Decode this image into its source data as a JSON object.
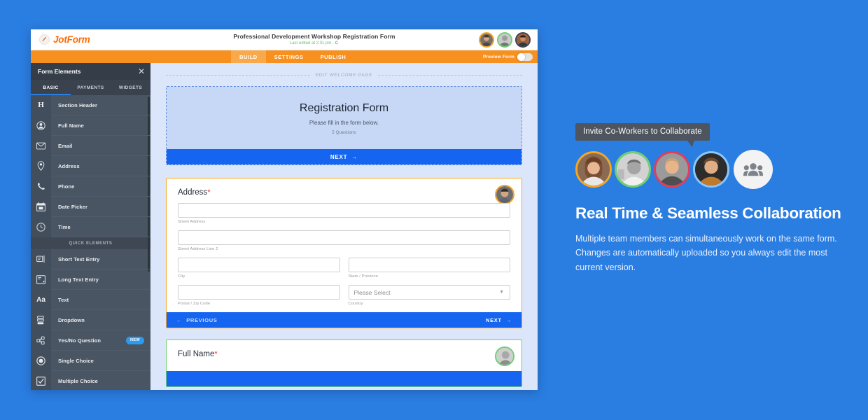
{
  "window": {
    "logo_text": "JotForm",
    "logo_icon": "jotform-pen-icon",
    "form_title": "Professional Development Workshop Registration Form",
    "last_edited": "Last edited at 2:31 pm.",
    "refresh_icon": "refresh-icon",
    "header_avatars": [
      {
        "name": "collaborator-avatar-1",
        "ring": "#f5a623"
      },
      {
        "name": "collaborator-avatar-2",
        "ring": "#6fcf72"
      },
      {
        "name": "collaborator-avatar-3",
        "ring": "#3a4250"
      }
    ],
    "nav_tabs": [
      {
        "label": "BUILD",
        "active": true
      },
      {
        "label": "SETTINGS",
        "active": false
      },
      {
        "label": "PUBLISH",
        "active": false
      }
    ],
    "preview": {
      "label": "Preview Form",
      "toggle_state": "off"
    }
  },
  "sidebar": {
    "title": "Form Elements",
    "close_icon": "close-icon",
    "tabs": [
      {
        "label": "BASIC",
        "active": true
      },
      {
        "label": "PAYMENTS",
        "active": false
      },
      {
        "label": "WIDGETS",
        "active": false
      }
    ],
    "section_label": "QUICK ELEMENTS",
    "items": [
      {
        "label": "Section Header",
        "icon": "heading-icon"
      },
      {
        "label": "Full Name",
        "icon": "person-icon"
      },
      {
        "label": "Email",
        "icon": "envelope-icon"
      },
      {
        "label": "Address",
        "icon": "map-pin-icon"
      },
      {
        "label": "Phone",
        "icon": "phone-icon"
      },
      {
        "label": "Date Picker",
        "icon": "calendar-icon"
      },
      {
        "label": "Time",
        "icon": "clock-icon"
      }
    ],
    "quick_items": [
      {
        "label": "Short Text Entry",
        "icon": "short-text-icon",
        "badge": ""
      },
      {
        "label": "Long Text Entry",
        "icon": "long-text-icon",
        "badge": ""
      },
      {
        "label": "Text",
        "icon": "text-aa-icon",
        "badge": ""
      },
      {
        "label": "Dropdown",
        "icon": "dropdown-icon",
        "badge": ""
      },
      {
        "label": "Yes/No Question",
        "icon": "yes-no-icon",
        "badge": "NEW"
      },
      {
        "label": "Single Choice",
        "icon": "radio-icon",
        "badge": ""
      },
      {
        "label": "Multiple Choice",
        "icon": "checkbox-icon",
        "badge": ""
      }
    ]
  },
  "canvas": {
    "welcome_divider_label": "EDIT WELCOME PAGE",
    "welcome": {
      "title": "Registration Form",
      "subtitle": "Please fill in the form below.",
      "question_count": "5 Questions",
      "next_label": "NEXT",
      "next_arrow": "→"
    },
    "address_card": {
      "title": "Address",
      "required_marker": "*",
      "avatar_ring": "#f5a623",
      "fields": [
        {
          "caption": "Street Address",
          "value": "",
          "type": "text"
        },
        {
          "caption": "Street Address Line 2",
          "value": "",
          "type": "text"
        },
        {
          "caption": "City",
          "value": "",
          "type": "text"
        },
        {
          "caption": "State / Province",
          "value": "",
          "type": "text"
        },
        {
          "caption": "Postal / Zip Code",
          "value": "",
          "type": "text"
        },
        {
          "caption": "Country",
          "value": "Please Select",
          "type": "select"
        }
      ],
      "previous_label": "PREVIOUS",
      "previous_arrow": "←",
      "next_label": "NEXT",
      "next_arrow": "→"
    },
    "fullname_card": {
      "title": "Full Name",
      "required_marker": "*",
      "avatar_ring": "#6fcf72"
    }
  },
  "promo": {
    "tooltip": "Invite Co-Workers to Collaborate",
    "avatars": [
      {
        "name": "promo-avatar-1",
        "ring": "#f5a623"
      },
      {
        "name": "promo-avatar-2",
        "ring": "#6fcf72"
      },
      {
        "name": "promo-avatar-3",
        "ring": "#e03e5c"
      },
      {
        "name": "promo-avatar-4",
        "ring": "#8ec6f5"
      }
    ],
    "group_icon": "people-group-icon",
    "heading": "Real Time & Seamless Collaboration",
    "body": "Multiple team members can simultaneously work on the same form. Changes are automatically uploaded so you always edit the most current version."
  },
  "colors": {
    "page_bg": "#2a7de1",
    "brand_orange": "#f7901e",
    "accent_blue": "#1565f0",
    "canvas_bg": "#dce6fa",
    "sidebar_bg": "#4a5563"
  }
}
